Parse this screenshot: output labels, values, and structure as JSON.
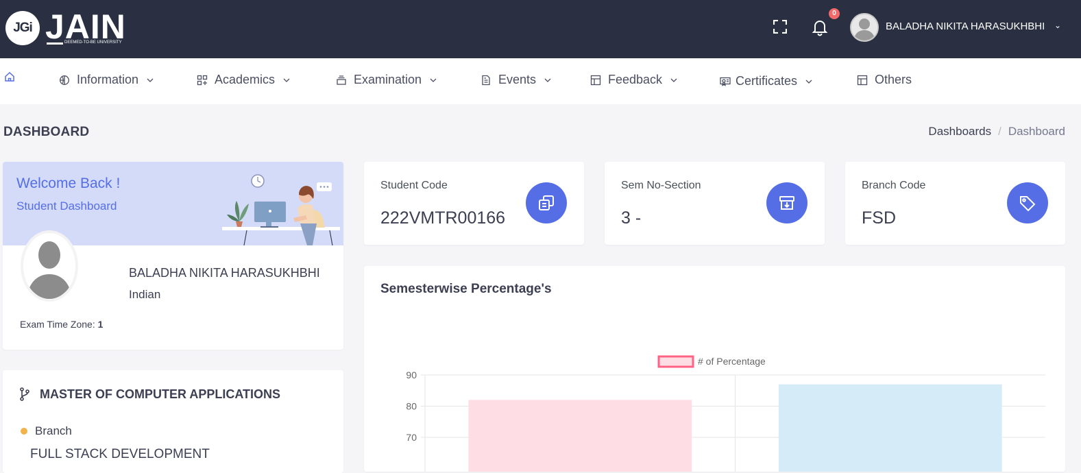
{
  "brand": {
    "logo_mark": "JGi",
    "logo_word": "JAIN",
    "logo_sub": "DEEMED-TO-BE UNIVERSITY"
  },
  "header": {
    "notification_count": "0",
    "user_name": "BALADHA NIKITA HARASUKHBHI",
    "caret": "⌄"
  },
  "nav": {
    "items": [
      {
        "label": "Information",
        "icon": "globe-icon"
      },
      {
        "label": "Academics",
        "icon": "grid-plus-icon"
      },
      {
        "label": "Examination",
        "icon": "stack-icon"
      },
      {
        "label": "Events",
        "icon": "document-icon"
      },
      {
        "label": "Feedback",
        "icon": "layout-icon"
      },
      {
        "label": "Certificates",
        "icon": "certificate-icon"
      },
      {
        "label": "Others",
        "icon": "layout-icon"
      }
    ]
  },
  "page": {
    "title": "DASHBOARD",
    "breadcrumb": [
      "Dashboards",
      "Dashboard"
    ]
  },
  "welcome": {
    "title": "Welcome Back !",
    "subtitle": "Student Dashboard",
    "name": "BALADHA NIKITA HARASUKHBHI",
    "nationality": "Indian",
    "tz_label": "Exam Time Zone:",
    "tz_value": "1"
  },
  "program": {
    "title": "MASTER OF COMPUTER APPLICATIONS",
    "branch_label": "Branch",
    "branch_value": "FULL STACK DEVELOPMENT"
  },
  "stats": [
    {
      "label": "Student Code",
      "value": "222VMTR00166",
      "icon": "copy-icon"
    },
    {
      "label": "Sem No-Section",
      "value": "3 -",
      "icon": "archive-download-icon"
    },
    {
      "label": "Branch Code",
      "value": "FSD",
      "icon": "tag-icon"
    }
  ],
  "colors": {
    "primary": "#556ee6",
    "topbar": "#2a3042",
    "welcome_bg": "#d4dbf9",
    "badge": "#f46a6a",
    "warning": "#f1b44c"
  },
  "chart_title": "Semesterwise Percentage's",
  "chart_data": {
    "type": "bar",
    "categories": [
      "",
      ""
    ],
    "series": [
      {
        "name": "# of Percentage",
        "values": [
          82,
          87
        ]
      }
    ],
    "bar_colors": [
      "#ffdde4",
      "#d6ebf8"
    ],
    "legend_color": "#ff6384",
    "yticks": [
      70,
      80,
      90
    ],
    "ylim": [
      67,
      90
    ],
    "legend_position": "top",
    "grid": true
  }
}
